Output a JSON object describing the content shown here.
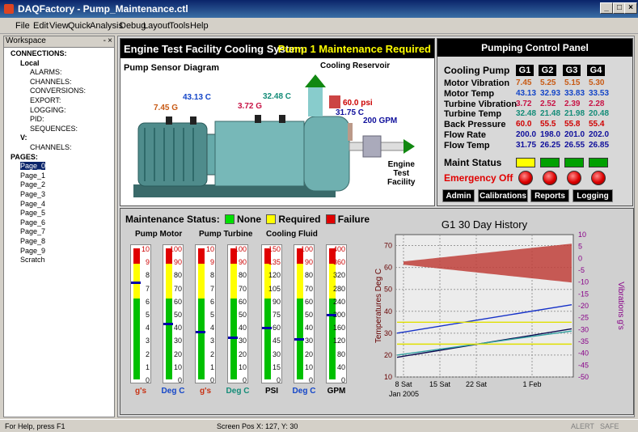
{
  "window": {
    "title": "DAQFactory - Pump_Maintenance.ctl"
  },
  "menu": [
    "File",
    "Edit",
    "View",
    "Quick",
    "Analysis",
    "Debug",
    "Layout",
    "Tools",
    "Help"
  ],
  "workspace": {
    "title": "Workspace",
    "tree": [
      {
        "label": "CONNECTIONS:",
        "level": 0
      },
      {
        "label": "Local",
        "level": 1
      },
      {
        "label": "ALARMS:",
        "level": 2
      },
      {
        "label": "CHANNELS:",
        "level": 2
      },
      {
        "label": "CONVERSIONS:",
        "level": 2
      },
      {
        "label": "EXPORT:",
        "level": 2
      },
      {
        "label": "LOGGING:",
        "level": 2
      },
      {
        "label": "PID:",
        "level": 2
      },
      {
        "label": "SEQUENCES:",
        "level": 2
      },
      {
        "label": "V:",
        "level": 1
      },
      {
        "label": "CHANNELS:",
        "level": 2
      },
      {
        "label": "PAGES:",
        "level": 0
      },
      {
        "label": "Page_0",
        "level": 1
      },
      {
        "label": "Page_1",
        "level": 1
      },
      {
        "label": "Page_2",
        "level": 1
      },
      {
        "label": "Page_3",
        "level": 1
      },
      {
        "label": "Page_4",
        "level": 1
      },
      {
        "label": "Page_5",
        "level": 1
      },
      {
        "label": "Page_6",
        "level": 1
      },
      {
        "label": "Page_7",
        "level": 1
      },
      {
        "label": "Page_8",
        "level": 1
      },
      {
        "label": "Page_9",
        "level": 1
      },
      {
        "label": "Scratch",
        "level": 1
      }
    ]
  },
  "diagram": {
    "title": "Engine Test Facility Cooling System:",
    "alert": "Pump 1 Maintenance Required",
    "subtitle": "Pump Sensor Diagram",
    "reservoir": "Cooling Reservoir",
    "pressure": "60.0 psi",
    "motor_vib": "7.45 G",
    "motor_temp": "43.13 C",
    "turb_vib": "3.72 G",
    "turb_temp": "32.48 C",
    "fluid_temp": "31.75 C",
    "flow": "200 GPM",
    "facility": "Engine\nTest\nFacility"
  },
  "panel": {
    "title": "Pumping Control Panel",
    "header": "Cooling Pump",
    "pumps": [
      "G1",
      "G2",
      "G3",
      "G4"
    ],
    "rows": [
      {
        "label": "Motor Vibration",
        "values": [
          "7.45",
          "5.25",
          "5.15",
          "5.30"
        ],
        "color": "#c85a14"
      },
      {
        "label": "Motor Temp",
        "values": [
          "43.13",
          "32.93",
          "33.83",
          "33.53"
        ],
        "color": "#1446c8"
      },
      {
        "label": "Turbine Vibration",
        "values": [
          "3.72",
          "2.52",
          "2.39",
          "2.28"
        ],
        "color": "#c81446"
      },
      {
        "label": "Turbine Temp",
        "values": [
          "32.48",
          "21.48",
          "21.98",
          "20.48"
        ],
        "color": "#148c78"
      },
      {
        "label": "Back Pressure",
        "values": [
          "60.0",
          "55.5",
          "55.8",
          "55.4"
        ],
        "color": "#d00000"
      },
      {
        "label": "Flow Rate",
        "values": [
          "200.0",
          "198.0",
          "201.0",
          "202.0"
        ],
        "color": "#10109c"
      },
      {
        "label": "Flow Temp",
        "values": [
          "31.75",
          "26.25",
          "26.55",
          "26.85"
        ],
        "color": "#10109c"
      }
    ],
    "maint_label": "Maint Status",
    "maint_colors": [
      "#ffff00",
      "#00a000",
      "#00a000",
      "#00a000"
    ],
    "emergency": "Emergency Off",
    "buttons": [
      "Admin",
      "Calibrations",
      "Reports",
      "Logging"
    ]
  },
  "maintenance": {
    "title": "Maintenance Status:",
    "legend": [
      {
        "label": "None",
        "color": "#00e000"
      },
      {
        "label": "Required",
        "color": "#ffff00"
      },
      {
        "label": "Failure",
        "color": "#e00000"
      }
    ],
    "groups": [
      "Pump Motor",
      "Pump Turbine",
      "Cooling Fluid"
    ],
    "gauges": [
      {
        "unit": "g's",
        "ticks": [
          "10",
          "9",
          "8",
          "7",
          "6",
          "5",
          "4",
          "3",
          "2",
          "1",
          "0"
        ],
        "value": 7.45,
        "max": 10,
        "unit_color": "#c83214"
      },
      {
        "unit": "Deg C",
        "ticks": [
          "100",
          "90",
          "80",
          "70",
          "60",
          "50",
          "40",
          "30",
          "20",
          "10",
          "0"
        ],
        "value": 43.13,
        "max": 100,
        "unit_color": "#1446c8"
      },
      {
        "unit": "g's",
        "ticks": [
          "10",
          "9",
          "8",
          "7",
          "6",
          "5",
          "4",
          "3",
          "2",
          "1",
          "0"
        ],
        "value": 3.72,
        "max": 10,
        "unit_color": "#c83214"
      },
      {
        "unit": "Deg C",
        "ticks": [
          "100",
          "90",
          "80",
          "70",
          "60",
          "50",
          "40",
          "30",
          "20",
          "10",
          "0"
        ],
        "value": 32.48,
        "max": 100,
        "unit_color": "#148c78"
      },
      {
        "unit": "PSI",
        "ticks": [
          "150",
          "135",
          "120",
          "105",
          "90",
          "75",
          "60",
          "45",
          "30",
          "15",
          "0"
        ],
        "value": 60,
        "max": 150,
        "unit_color": "#000000"
      },
      {
        "unit": "Deg C",
        "ticks": [
          "100",
          "90",
          "80",
          "70",
          "60",
          "50",
          "40",
          "30",
          "20",
          "10",
          "0"
        ],
        "value": 31.75,
        "max": 100,
        "unit_color": "#1446c8"
      },
      {
        "unit": "GPM",
        "ticks": [
          "400",
          "360",
          "320",
          "280",
          "240",
          "200",
          "160",
          "120",
          "80",
          "40",
          "0"
        ],
        "value": 200,
        "max": 400,
        "unit_color": "#000000"
      }
    ]
  },
  "chart_data": {
    "type": "line",
    "title": "G1 30 Day History",
    "ylabel": "Temperatures Deg C",
    "y2label": "Vibrations g's",
    "ylim": [
      10,
      75
    ],
    "y2lim": [
      -50,
      10
    ],
    "yticks": [
      "70",
      "60",
      "50",
      "40",
      "30",
      "20",
      "10"
    ],
    "y2ticks": [
      "10",
      "5",
      "0",
      "-5",
      "-10",
      "-15",
      "-20",
      "-25",
      "-30",
      "-35",
      "-40",
      "-45",
      "-50"
    ],
    "xticks": [
      "8 Sat",
      "15 Sat",
      "22 Sat",
      "1 Feb"
    ],
    "xsub": "Jan 2005",
    "series": [
      {
        "color": "#1430c8",
        "x": [
          0,
          1
        ],
        "y": [
          30,
          43
        ]
      },
      {
        "color": "#0a0a50",
        "x": [
          0,
          1
        ],
        "y": [
          19,
          32
        ]
      },
      {
        "color": "#30a0a0",
        "x": [
          0,
          1
        ],
        "y": [
          20,
          31
        ]
      },
      {
        "color": "#e0e000",
        "x": [
          0,
          1
        ],
        "y": [
          35,
          35
        ]
      },
      {
        "color": "#e0e000",
        "x": [
          0,
          1
        ],
        "y": [
          25,
          25
        ]
      }
    ]
  },
  "status": {
    "help": "For Help, press F1",
    "pos": "Screen Pos X: 127, Y: 30",
    "alert": "ALERT",
    "safe": "SAFE"
  }
}
